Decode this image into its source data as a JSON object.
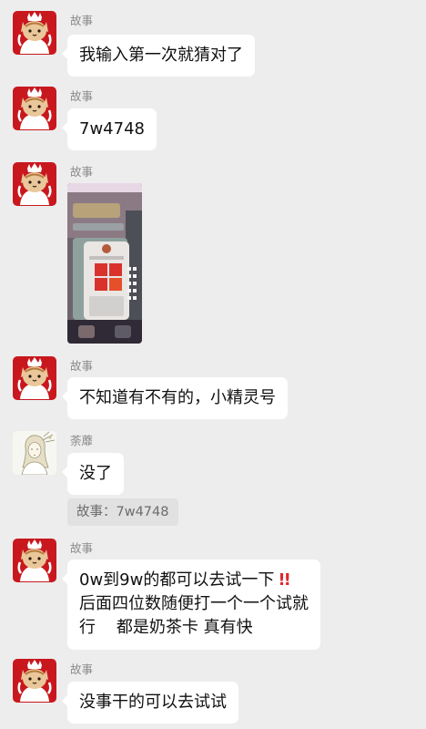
{
  "messages": [
    {
      "sender": "故事",
      "type": "text",
      "text": "我输入第一次就猜对了"
    },
    {
      "sender": "故事",
      "type": "text",
      "text": "7w4748"
    },
    {
      "sender": "故事",
      "type": "image"
    },
    {
      "sender": "故事",
      "type": "text",
      "text": "不知道有不有的，小精灵号"
    },
    {
      "sender": "荼蘼",
      "type": "text",
      "text": "没了",
      "quote": "故事：7w4748"
    },
    {
      "sender": "故事",
      "type": "text",
      "lines": [
        "0w到9w的都可以去试一下",
        "后面四位数随便打一个一个试就",
        "行    都是奶茶卡 真有快"
      ],
      "emoji": "!!"
    },
    {
      "sender": "故事",
      "type": "text",
      "text": "没事干的可以去试试"
    }
  ],
  "colors": {
    "background": "#ededed",
    "bubble": "#ffffff",
    "avatar_cat_red": "#c8181e",
    "emoji_red": "#e0262c"
  },
  "icons": {
    "cat_avatar": "cartoon-cat-avatar-icon",
    "girl_avatar": "sketch-girl-avatar-icon",
    "emoji": "double-exclamation-emoji-icon"
  }
}
